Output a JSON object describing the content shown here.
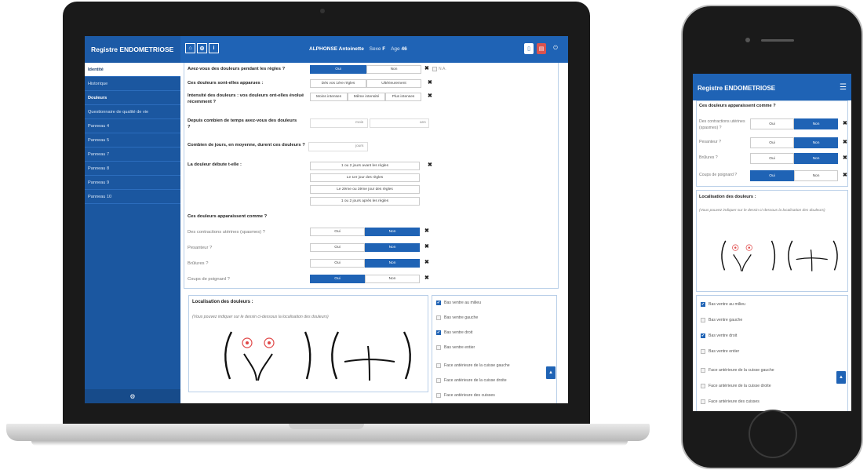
{
  "app": {
    "title": "Registre ENDOMETRIOSE",
    "patient": {
      "name": "ALPHONSE Antoinette",
      "sex_label": "Sexe",
      "sex": "F",
      "age_label": "Age",
      "age": "46"
    },
    "toolbar_icons": [
      "home-icon",
      "gear-icon",
      "info-icon"
    ],
    "right_icons": [
      "document-icon",
      "pdf-icon",
      "power-icon"
    ]
  },
  "sidebar": {
    "items": [
      {
        "label": "Identité"
      },
      {
        "label": "Historique"
      },
      {
        "label": "Douleurs"
      },
      {
        "label": "Questionnaire de qualité de vie"
      },
      {
        "label": "Panneau 4"
      },
      {
        "label": "Panneau 5"
      },
      {
        "label": "Panneau 7"
      },
      {
        "label": "Panneau 8"
      },
      {
        "label": "Panneau 9"
      },
      {
        "label": "Panneau 10"
      }
    ]
  },
  "form": {
    "q1": {
      "label": "Avez-vous des douleurs pendant les règles ?",
      "opt_yes": "Oui",
      "opt_no": "Non",
      "na": "N.A."
    },
    "q2": {
      "label": "Ces douleurs sont-elles apparues :",
      "opt_a": "Dès vos 1ère règles",
      "opt_b": "Ultérieurement"
    },
    "q3": {
      "label": "Intensité des douleurs : vos douleurs ont-elles évolué récemment ?",
      "opt_a": "Moins intenses",
      "opt_b": "Même intensité",
      "opt_c": "Plus intenses"
    },
    "q4": {
      "label": "Depuis combien de temps avez-vous des douleurs ?",
      "unit_a": "mois",
      "unit_b": "ans"
    },
    "q5": {
      "label": "Combien de jours, en moyenne, durent ces douleurs ?",
      "unit": "jours"
    },
    "q6": {
      "label": "La douleur débute t-elle :",
      "opts": [
        "1 ou 2 jours avant les règles",
        "Le 1er jour des règles",
        "Le 2ème ou 3ème jour des règles",
        "1 ou 2 jours après les règles"
      ]
    },
    "q7": {
      "label": "Ces douleurs apparaissent comme ?",
      "rows": [
        {
          "label": "Des contractions utérines (spasmes) ?",
          "yes": "Oui",
          "no": "Non",
          "selected": "Non"
        },
        {
          "label": "Pesanteur ?",
          "yes": "Oui",
          "no": "Non",
          "selected": "Non"
        },
        {
          "label": "Brûlures ?",
          "yes": "Oui",
          "no": "Non",
          "selected": "Non"
        },
        {
          "label": "Coups de poignard ?",
          "yes": "Oui",
          "no": "Non",
          "selected": "Oui"
        }
      ]
    },
    "loc": {
      "title": "Localisation des douleurs :",
      "subtitle": "(Vous pouvez indiquer sur le dessin ci-dessous la localisation des douleurs)"
    },
    "checks": [
      {
        "label": "Bas ventre au milieu",
        "checked": true
      },
      {
        "label": "Bas ventre gauche",
        "checked": false
      },
      {
        "label": "Bas ventre droit",
        "checked": true
      },
      {
        "label": "Bas ventre entier",
        "checked": false
      },
      {
        "label": "Face antérieure de la cuisse gauche",
        "checked": false
      },
      {
        "label": "Face antérieure de la cuisse droite",
        "checked": false
      },
      {
        "label": "Face antérieure des cuisses",
        "checked": false
      }
    ]
  },
  "phone": {
    "q_label": "Ces douleurs apparaissent comme ?",
    "rows": [
      {
        "label": "Des contractions utérines (spasmes) ?",
        "yes": "Oui",
        "no": "Non",
        "selected": "Non"
      },
      {
        "label": "Pesanteur ?",
        "yes": "Oui",
        "no": "Non",
        "selected": "Non"
      },
      {
        "label": "Brûlures ?",
        "yes": "Oui",
        "no": "Non",
        "selected": "Non"
      },
      {
        "label": "Coups de poignard ?",
        "yes": "Oui",
        "no": "Non",
        "selected": "Oui"
      }
    ],
    "loc_title": "Localisation des douleurs :",
    "loc_subtitle": "(Vous pouvez indiquer sur le dessin ci-dessous la localisation des douleurs)",
    "checks": [
      {
        "label": "Bas ventre au milieu",
        "checked": true
      },
      {
        "label": "Bas ventre gauche",
        "checked": false
      },
      {
        "label": "Bas ventre droit",
        "checked": true
      },
      {
        "label": "Bas ventre entier",
        "checked": false
      },
      {
        "label": "Face antérieure de la cuisse gauche",
        "checked": false
      },
      {
        "label": "Face antérieure de la cuisse droite",
        "checked": false
      },
      {
        "label": "Face antérieure des cuisses",
        "checked": false
      }
    ]
  },
  "colors": {
    "accent": "#1f63b5",
    "sidebar": "#1b57a0",
    "pain_marker": "#e04848"
  }
}
